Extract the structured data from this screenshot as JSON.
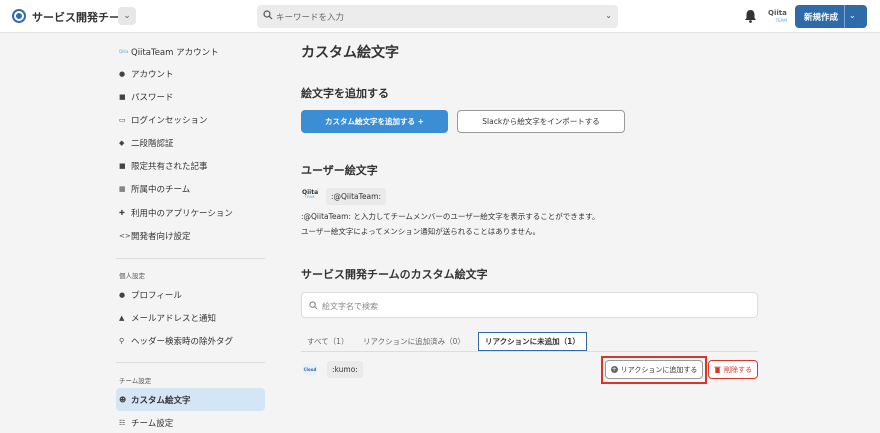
{
  "header": {
    "team_name": "サービス開発チーム",
    "search_placeholder": "キーワードを入力",
    "qiita_logo": "Qiita",
    "qiita_logo_sub": "TEAM",
    "new_button": "新規作成"
  },
  "sidebar": {
    "account_heading": "QiitaTeam アカウント",
    "account_items": [
      {
        "label": "アカウント",
        "icon": "person-icon"
      },
      {
        "label": "パスワード",
        "icon": "lock-icon"
      },
      {
        "label": "ログインセッション",
        "icon": "login-session-icon"
      },
      {
        "label": "二段階認証",
        "icon": "shield-icon"
      },
      {
        "label": "限定共有された記事",
        "icon": "lock-icon"
      },
      {
        "label": "所属中のチーム",
        "icon": "building-icon"
      },
      {
        "label": "利用中のアプリケーション",
        "icon": "puzzle-icon"
      },
      {
        "label": "開発者向け設定",
        "icon": "code-icon"
      }
    ],
    "personal_heading": "個人設定",
    "personal_items": [
      {
        "label": "プロフィール",
        "icon": "person-icon"
      },
      {
        "label": "メールアドレスと通知",
        "icon": "bell-icon"
      },
      {
        "label": "ヘッダー検索時の除外タグ",
        "icon": "tag-search-icon"
      }
    ],
    "team_heading": "チーム設定",
    "team_items": [
      {
        "label": "カスタム絵文字",
        "icon": "smile-icon",
        "active": true
      },
      {
        "label": "チーム設定",
        "icon": "sliders-icon"
      }
    ]
  },
  "main": {
    "title": "カスタム絵文字",
    "add_section_title": "絵文字を追加する",
    "add_custom_button": "カスタム絵文字を追加する +",
    "import_slack_button": "Slackから絵文字をインポートする",
    "user_emoji_title": "ユーザー絵文字",
    "user_emoji_logo": "Qiita",
    "user_emoji_logo_sub": "TEAM",
    "user_emoji_code": ":@QiitaTeam:",
    "desc_line1": ":@QiitaTeam: と入力してチームメンバーのユーザー絵文字を表示することができます。",
    "desc_line2": "ユーザー絵文字によってメンション通知が送られることはありません。",
    "team_emoji_title": "サービス開発チームのカスタム絵文字",
    "emoji_search_placeholder": "絵文字名で検索",
    "tabs": [
      {
        "label": "すべて（1）"
      },
      {
        "label": "リアクションに追加済み（0）"
      },
      {
        "label": "リアクションに未追加（1）",
        "active": true
      }
    ],
    "emoji_row": {
      "logo_text": "Cloud",
      "code": ":kumo:",
      "add_reaction_button": "リアクションに追加する",
      "delete_button": "削除する"
    }
  },
  "colors": {
    "brand_blue": "#2f6ba8",
    "primary_button": "#3b8dd4",
    "active_sidebar": "#d4e5f6",
    "danger": "#d9362b"
  }
}
